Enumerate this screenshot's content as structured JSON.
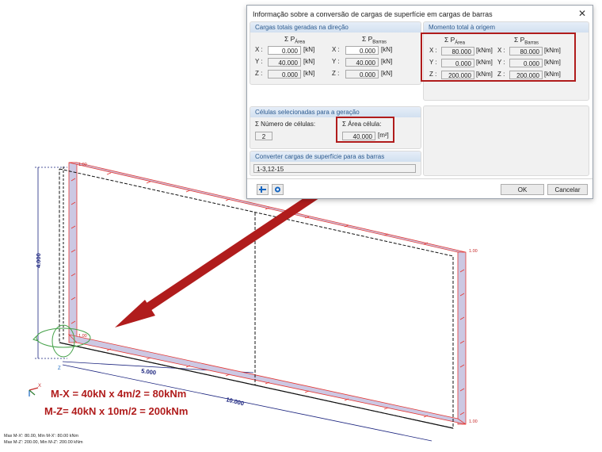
{
  "dialog": {
    "title": "Informação sobre a conversão de cargas de superfície em cargas de barras",
    "close": "✕",
    "totals": {
      "header": "Cargas totais geradas na direção",
      "col1": {
        "sigma": "Σ P",
        "sub": "Área"
      },
      "col2": {
        "sigma": "Σ P",
        "sub": "Barras"
      },
      "rows": [
        {
          "axis": "X :",
          "a": "0.000",
          "b": "0.000",
          "unit": "[kN]"
        },
        {
          "axis": "Y :",
          "a": "40.000",
          "b": "40.000",
          "unit": "[kN]"
        },
        {
          "axis": "Z :",
          "a": "0.000",
          "b": "0.000",
          "unit": "[kN]"
        }
      ]
    },
    "moment": {
      "header": "Momento total à origem",
      "col1": {
        "sigma": "Σ P",
        "sub": "Área"
      },
      "col2": {
        "sigma": "Σ P",
        "sub": "Barras"
      },
      "rows": [
        {
          "axis": "X :",
          "a": "80.000",
          "b": "80.000",
          "unit": "[kNm]"
        },
        {
          "axis": "Y :",
          "a": "0.000",
          "b": "0.000",
          "unit": "[kNm]"
        },
        {
          "axis": "Z :",
          "a": "200.000",
          "b": "200.000",
          "unit": "[kNm]"
        }
      ]
    },
    "cells": {
      "header": "Células selecionadas para a geração",
      "count_label": "Σ Número de células:",
      "count": "2",
      "area_label": "Σ Área célula:",
      "area": "40.000",
      "area_unit": "[m²]"
    },
    "convert": {
      "header": "Converter cargas de superfície para as barras",
      "value": "1-3,12-15"
    },
    "ok": "OK",
    "cancel": "Cancelar"
  },
  "model": {
    "dim_height": "4.000",
    "dim_mid": "5.000",
    "dim_total": "10.000",
    "load_value": "1.00",
    "axis_x": "X",
    "axis_z": "Z",
    "node_label": "2"
  },
  "formulas": {
    "line1": "M-X = 40kN x 4m/2 = 80kNm",
    "line2": "M-Z= 40kN x 10m/2 = 200kNm"
  },
  "status": {
    "line1": "Max M-X': 80.00, Min M-X': 80.00 kNm",
    "line2": "Max M-Z': 200.00, Min M-Z': 200.00 kNm"
  },
  "colors": {
    "accent_red": "#b01c1c",
    "load_red": "#e53935",
    "dim_blue": "#1a237e"
  }
}
